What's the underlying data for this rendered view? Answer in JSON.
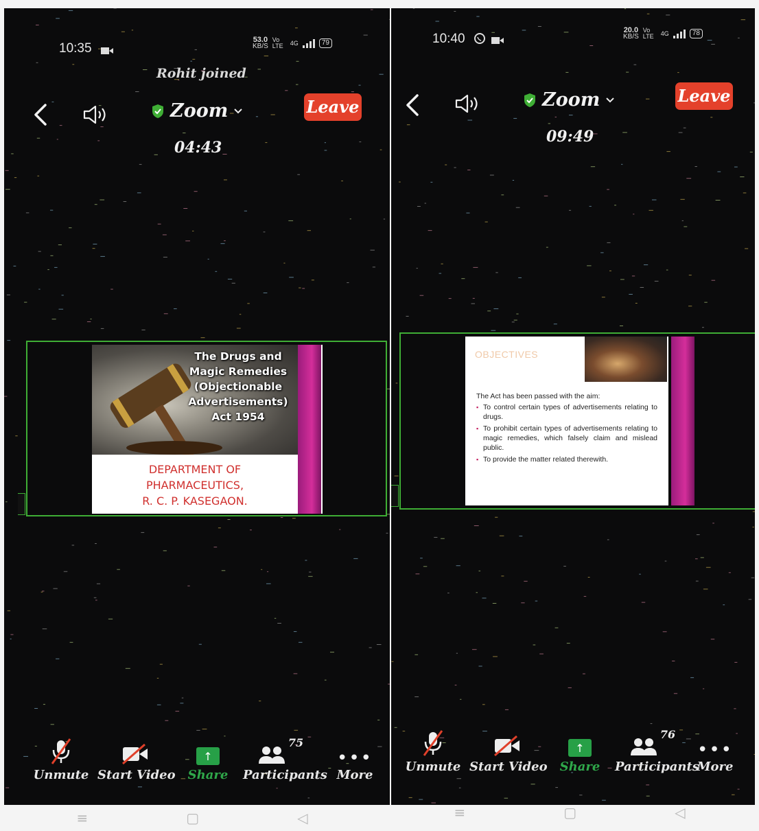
{
  "left": {
    "status": {
      "time": "10:35",
      "speed_value": "53.0",
      "speed_unit": "KB/S",
      "network": "Vo LTE",
      "net_type": "4G",
      "battery": "79"
    },
    "notification": "Rohit joined",
    "header": {
      "title": "Zoom",
      "leave_label": "Leave",
      "timer": "04:43"
    },
    "slide": {
      "title_lines": [
        "The Drugs and",
        "Magic Remedies",
        "(Objectionable",
        "Advertisements)",
        "Act 1954"
      ],
      "department_lines": [
        "DEPARTMENT OF",
        "PHARMACEUTICS,",
        "R. C. P. KASEGAON."
      ]
    },
    "toolbar": {
      "unmute": "Unmute",
      "start_video": "Start Video",
      "share": "Share",
      "participants": "Participants",
      "participants_count": "75",
      "more": "More"
    }
  },
  "right": {
    "status": {
      "time": "10:40",
      "speed_value": "20.0",
      "speed_unit": "KB/S",
      "network": "Vo LTE",
      "net_type": "4G",
      "battery": "78"
    },
    "header": {
      "title": "Zoom",
      "leave_label": "Leave",
      "timer": "09:49"
    },
    "slide": {
      "heading": "OBJECTIVES",
      "intro": "The Act has been passed with the aim:",
      "bullets": [
        "To control certain types of advertisements relating to drugs.",
        "To prohibit certain types of advertisements relating to magic remedies, which falsely claim and mislead public.",
        "To provide the matter related therewith."
      ]
    },
    "toolbar": {
      "unmute": "Unmute",
      "start_video": "Start Video",
      "share": "Share",
      "participants": "Participants",
      "participants_count": "76",
      "more": "More"
    }
  },
  "colors": {
    "leave": "#e4412b",
    "share": "#27a047",
    "frame": "#3fae35",
    "shield": "#3fae35",
    "slide_accent": "#c2185b",
    "dept_text": "#d0302e"
  },
  "icons": [
    "back-chevron-icon",
    "speaker-icon",
    "shield-check-icon",
    "chevron-down-icon",
    "mic-muted-icon",
    "video-off-icon",
    "share-arrow-icon",
    "participants-icon",
    "more-dots-icon",
    "video-camera-icon",
    "whatsapp-icon"
  ]
}
